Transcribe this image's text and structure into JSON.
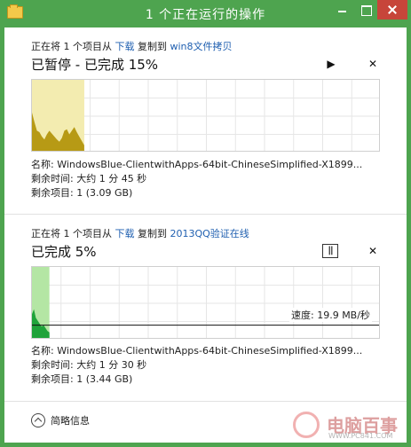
{
  "window": {
    "title": "1 个正在运行的操作"
  },
  "operations": [
    {
      "head_prefix": "正在将 1 个项目从 ",
      "source": "下载",
      "head_mid": " 复制到 ",
      "destination": "win8文件拷贝",
      "status": "已暂停 - 已完成 15%",
      "progress_fraction": 0.15,
      "state": "paused",
      "name_label": "名称: WindowsBlue-ClientwithApps-64bit-ChineseSimplified-X1899...",
      "time_label": "剩余时间: 大约 1 分 45 秒",
      "items_label": "剩余项目: 1 (3.09 GB)",
      "graph_fill": "#f3ecb0",
      "graph_area": "#b79a15",
      "speed_values": [
        0.55,
        0.42,
        0.3,
        0.28,
        0.22,
        0.18,
        0.25,
        0.3,
        0.26,
        0.22,
        0.18,
        0.15,
        0.2,
        0.3,
        0.32,
        0.25,
        0.3,
        0.35,
        0.28,
        0.22,
        0.16,
        0.1
      ]
    },
    {
      "head_prefix": "正在将 1 个项目从 ",
      "source": "下载",
      "head_mid": " 复制到 ",
      "destination": "2013QQ验证在线",
      "status": "已完成 5%",
      "progress_fraction": 0.05,
      "state": "running",
      "speed_text": "速度: 19.9 MB/秒",
      "name_label": "名称: WindowsBlue-ClientwithApps-64bit-ChineseSimplified-X1899...",
      "time_label": "剩余时间: 大约 1 分 30 秒",
      "items_label": "剩余项目: 1 (3.44 GB)",
      "graph_fill": "#b4e6a4",
      "graph_area": "#1fa33a",
      "speed_values": [
        0.35,
        0.42,
        0.3,
        0.26,
        0.22,
        0.18,
        0.2,
        0.16,
        0.12,
        0.1
      ]
    }
  ],
  "footer": {
    "less_details_label": "简略信息"
  },
  "watermark": {
    "text": "电脑百事网",
    "sub": "WWW.PC841.COM"
  },
  "colors": {
    "accent": "#4ea44f",
    "link": "#1f5fb0"
  }
}
